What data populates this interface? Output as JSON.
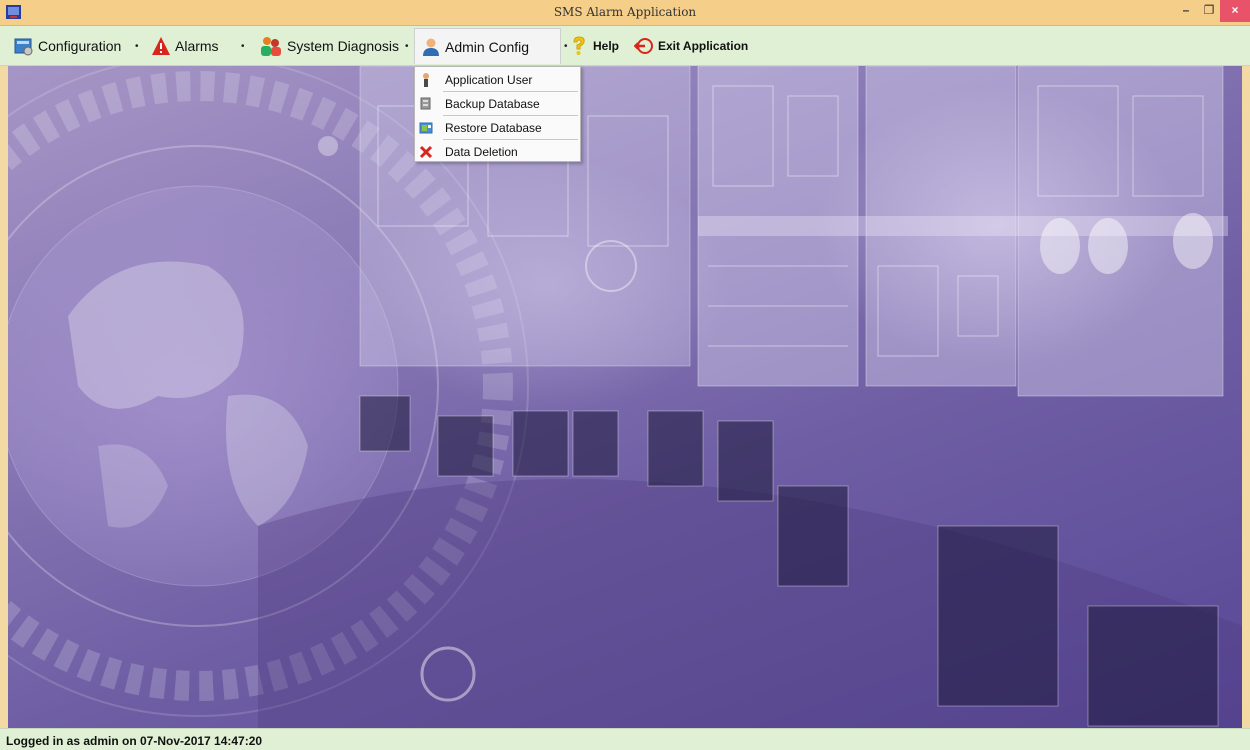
{
  "window": {
    "title": "SMS Alarm Application",
    "minimize_glyph": "–",
    "maximize_glyph": "❐",
    "close_glyph": "×"
  },
  "menubar": {
    "items": [
      {
        "label": "Configuration",
        "icon": "configuration-icon"
      },
      {
        "label": "Alarms",
        "icon": "warning-icon"
      },
      {
        "label": "System Diagnosis",
        "icon": "diagnosis-icon"
      },
      {
        "label": "Admin Config",
        "icon": "admin-user-icon"
      },
      {
        "label": "Help",
        "icon": "help-icon"
      },
      {
        "label": "Exit Application",
        "icon": "exit-icon"
      }
    ],
    "dropdown_glyph": "•"
  },
  "admin_menu": {
    "items": [
      {
        "label": "Application User",
        "icon": "user-icon"
      },
      {
        "label": "Backup Database",
        "icon": "backup-icon"
      },
      {
        "label": "Restore Database",
        "icon": "restore-icon"
      },
      {
        "label": "Data Deletion",
        "icon": "delete-icon"
      }
    ]
  },
  "status": {
    "text": "Logged in as admin on 07-Nov-2017 14:47:20"
  },
  "colors": {
    "titlebar": "#f5cf8a",
    "menubar": "#dff0d4",
    "close_button": "#e8536a",
    "desktop_purple": "#6f5ea4"
  }
}
